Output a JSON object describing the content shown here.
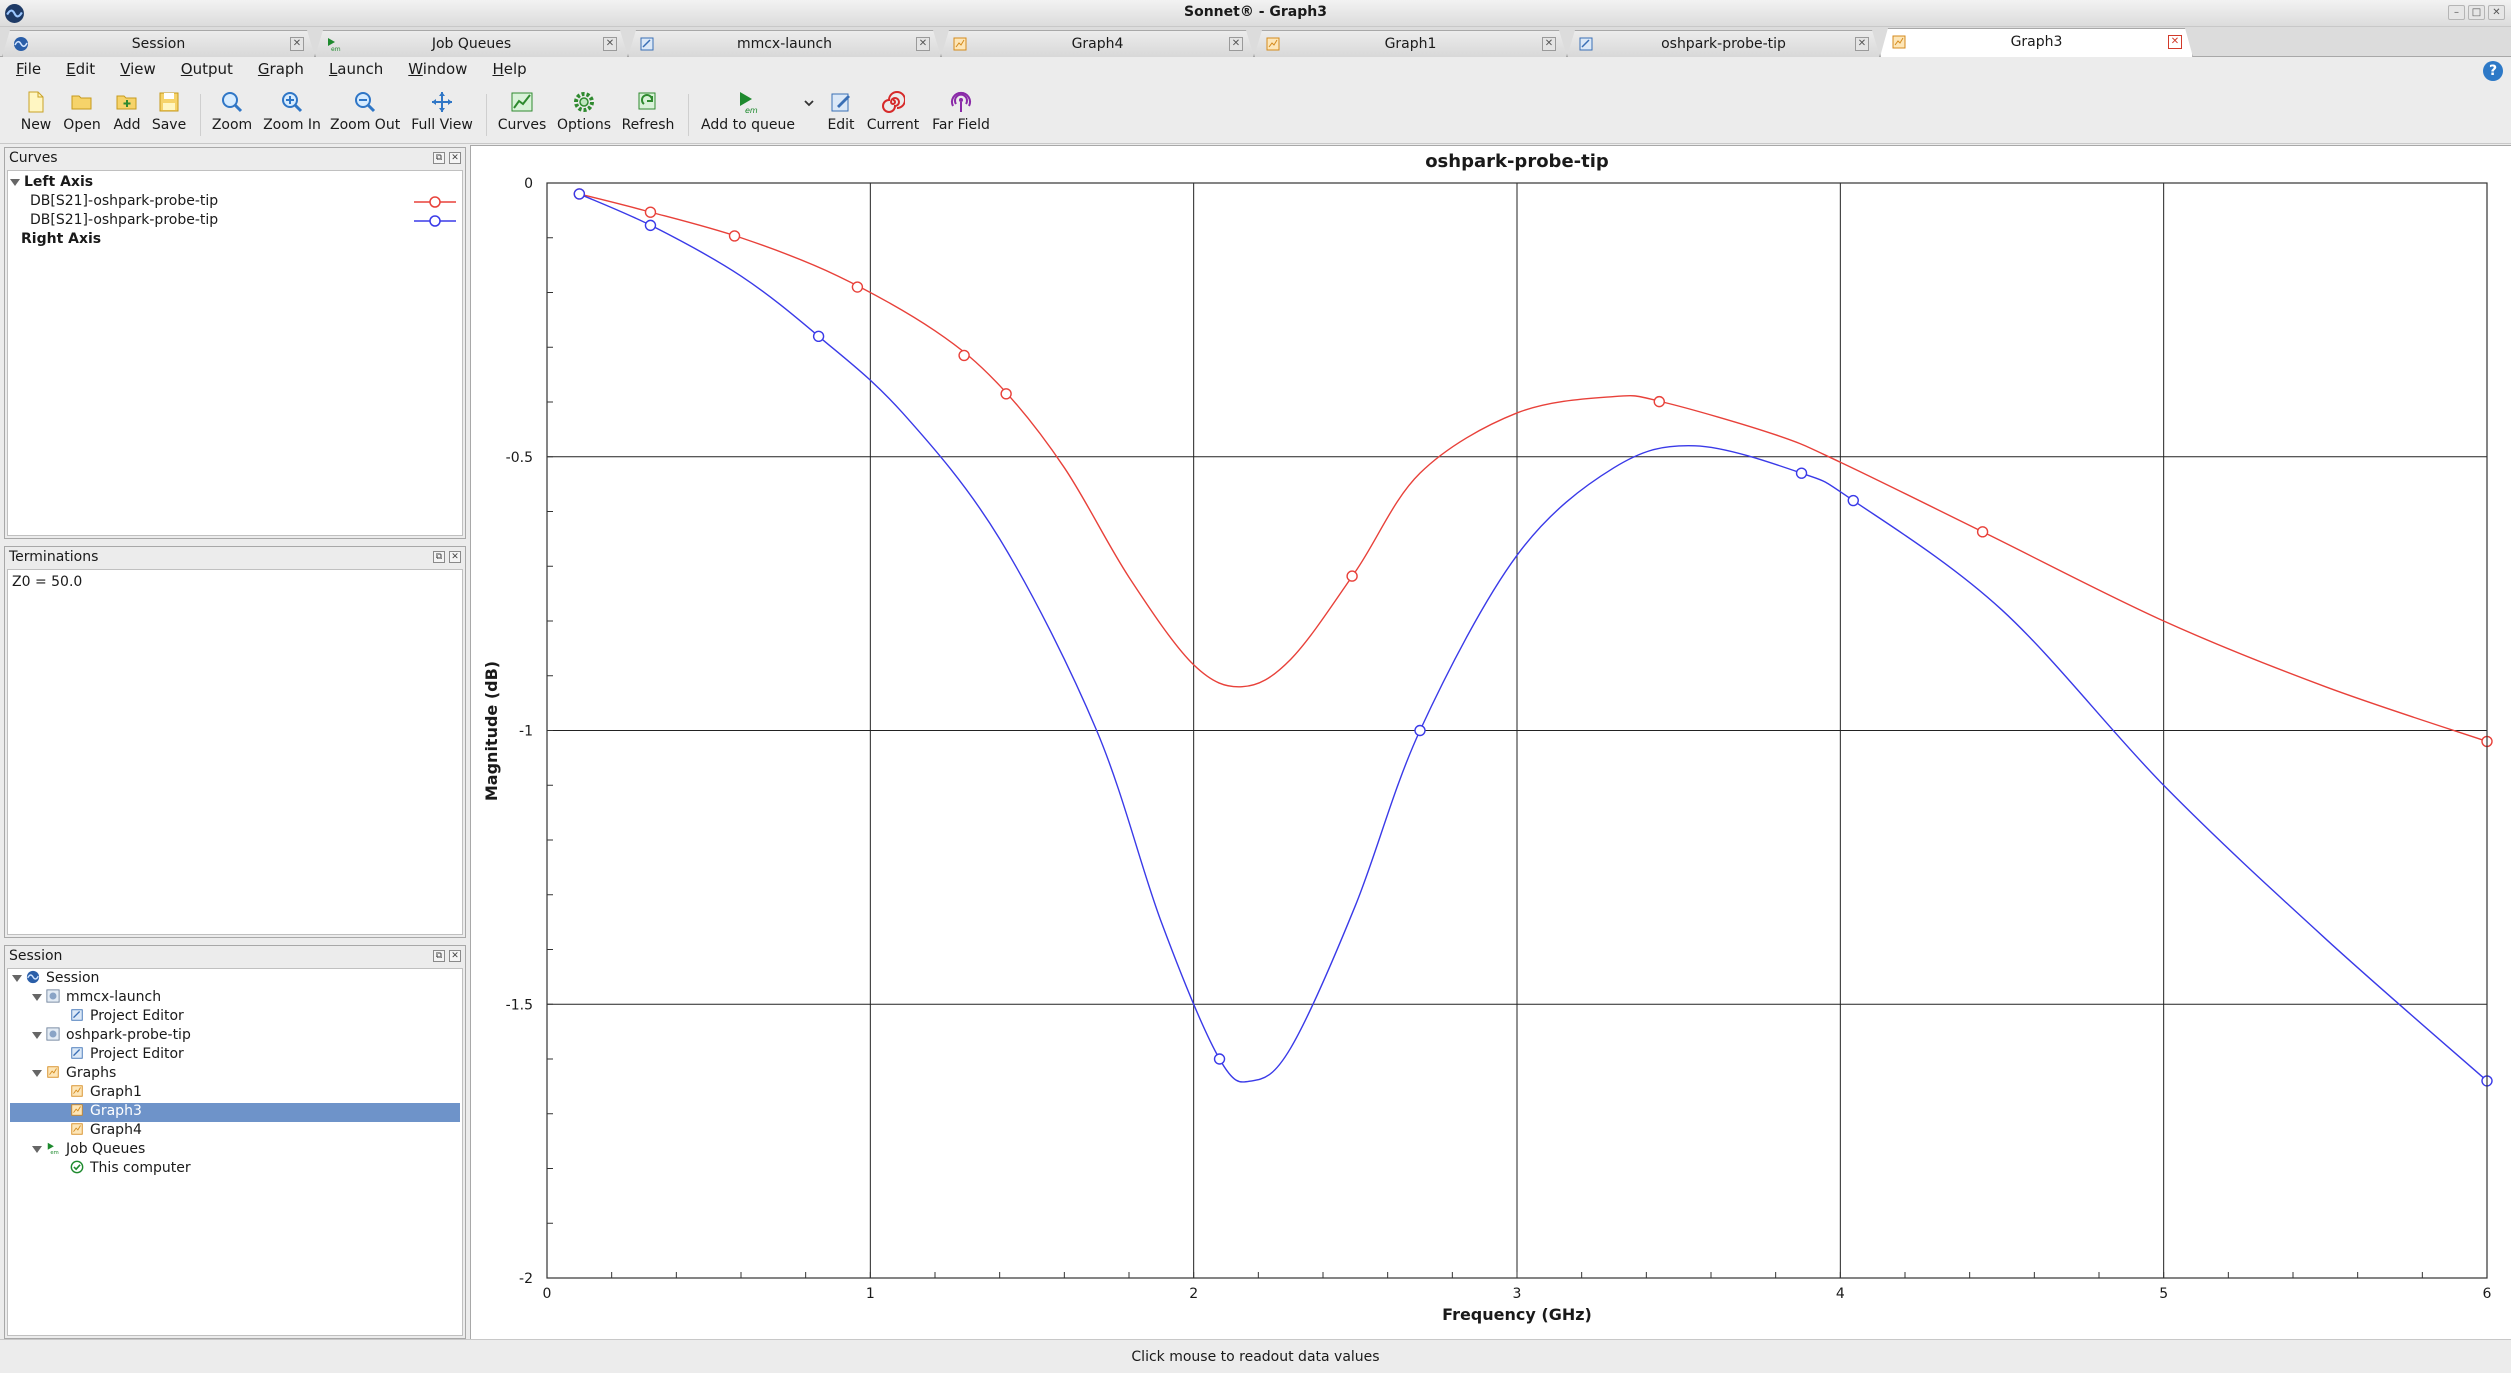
{
  "window": {
    "title": "Sonnet® - Graph3"
  },
  "tabs": [
    {
      "label": "Session",
      "icon": "session-icon"
    },
    {
      "label": "Job Queues",
      "icon": "em-queue-icon"
    },
    {
      "label": "mmcx-launch",
      "icon": "project-icon"
    },
    {
      "label": "Graph4",
      "icon": "graph-icon"
    },
    {
      "label": "Graph1",
      "icon": "graph-icon"
    },
    {
      "label": "oshpark-probe-tip",
      "icon": "project-icon"
    },
    {
      "label": "Graph3",
      "icon": "graph-icon",
      "active": true
    }
  ],
  "menu": [
    "File",
    "Edit",
    "View",
    "Output",
    "Graph",
    "Launch",
    "Window",
    "Help"
  ],
  "toolbar": {
    "new": "New",
    "open": "Open",
    "add": "Add",
    "save": "Save",
    "zoom": "Zoom",
    "zoom_in": "Zoom In",
    "zoom_out": "Zoom Out",
    "full_view": "Full View",
    "curves": "Curves",
    "options": "Options",
    "refresh": "Refresh",
    "add_to_queue": "Add to queue",
    "edit": "Edit",
    "current": "Current",
    "far_field": "Far Field"
  },
  "curves_panel": {
    "title": "Curves",
    "left_axis": "Left Axis",
    "right_axis": "Right Axis",
    "items": [
      {
        "label": "DB[S21]-oshpark-probe-tip",
        "color": "#e8413a"
      },
      {
        "label": "DB[S21]-oshpark-probe-tip",
        "color": "#3a3ae8"
      }
    ]
  },
  "terminations_panel": {
    "title": "Terminations",
    "z0": "Z0 = 50.0"
  },
  "session_panel": {
    "title": "Session",
    "root": "Session",
    "mmcx": "mmcx-launch",
    "mmcx_editor": "Project Editor",
    "osh": "oshpark-probe-tip",
    "osh_editor": "Project Editor",
    "graphs": "Graphs",
    "graph1": "Graph1",
    "graph3": "Graph3",
    "graph4": "Graph4",
    "job_queues": "Job Queues",
    "this_computer": "This computer"
  },
  "status": {
    "message": "Click mouse to readout data values"
  },
  "chart_data": {
    "type": "line",
    "title": "oshpark-probe-tip",
    "xlabel": "Frequency (GHz)",
    "ylabel": "Magnitude (dB)",
    "xlim": [
      0,
      6
    ],
    "ylim": [
      -2,
      0
    ],
    "xticks": [
      "0",
      "1",
      "2",
      "3",
      "4",
      "5",
      "6"
    ],
    "yticks": [
      "0",
      "-0.5",
      "-1",
      "-1.5",
      "-2"
    ],
    "grid": true,
    "series": [
      {
        "name": "DB[S21]-oshpark-probe-tip",
        "color": "#e8413a",
        "x": [
          0.1,
          0.3,
          0.6,
          0.9,
          1.2,
          1.4,
          1.6,
          1.8,
          2.0,
          2.15,
          2.3,
          2.5,
          2.7,
          3.0,
          3.3,
          3.45,
          3.8,
          4.0,
          4.45,
          5.0,
          5.5,
          6.0
        ],
        "y": [
          -0.02,
          -0.05,
          -0.1,
          -0.17,
          -0.27,
          -0.37,
          -0.52,
          -0.72,
          -0.88,
          -0.92,
          -0.87,
          -0.71,
          -0.53,
          -0.42,
          -0.39,
          -0.4,
          -0.46,
          -0.51,
          -0.64,
          -0.8,
          -0.92,
          -1.02
        ]
      },
      {
        "name": "DB[S21]-oshpark-probe-tip",
        "color": "#3a3ae8",
        "x": [
          0.1,
          0.33,
          0.6,
          0.84,
          1.1,
          1.4,
          1.7,
          1.9,
          2.08,
          2.18,
          2.3,
          2.5,
          2.7,
          3.0,
          3.3,
          3.55,
          3.88,
          4.04,
          4.5,
          5.0,
          5.5,
          6.0
        ],
        "y": [
          -0.02,
          -0.08,
          -0.17,
          -0.28,
          -0.42,
          -0.65,
          -1.0,
          -1.35,
          -1.6,
          -1.64,
          -1.58,
          -1.32,
          -1.0,
          -0.68,
          -0.52,
          -0.48,
          -0.53,
          -0.58,
          -0.78,
          -1.1,
          -1.38,
          -1.64
        ]
      }
    ],
    "markers": [
      {
        "series": 0,
        "x": [
          0.1,
          0.32,
          0.58,
          0.96,
          1.29,
          1.42,
          2.49,
          3.44,
          4.44,
          6.0
        ]
      },
      {
        "series": 1,
        "x": [
          0.1,
          0.32,
          0.84,
          2.08,
          2.7,
          3.88,
          4.04,
          6.0
        ]
      }
    ]
  }
}
